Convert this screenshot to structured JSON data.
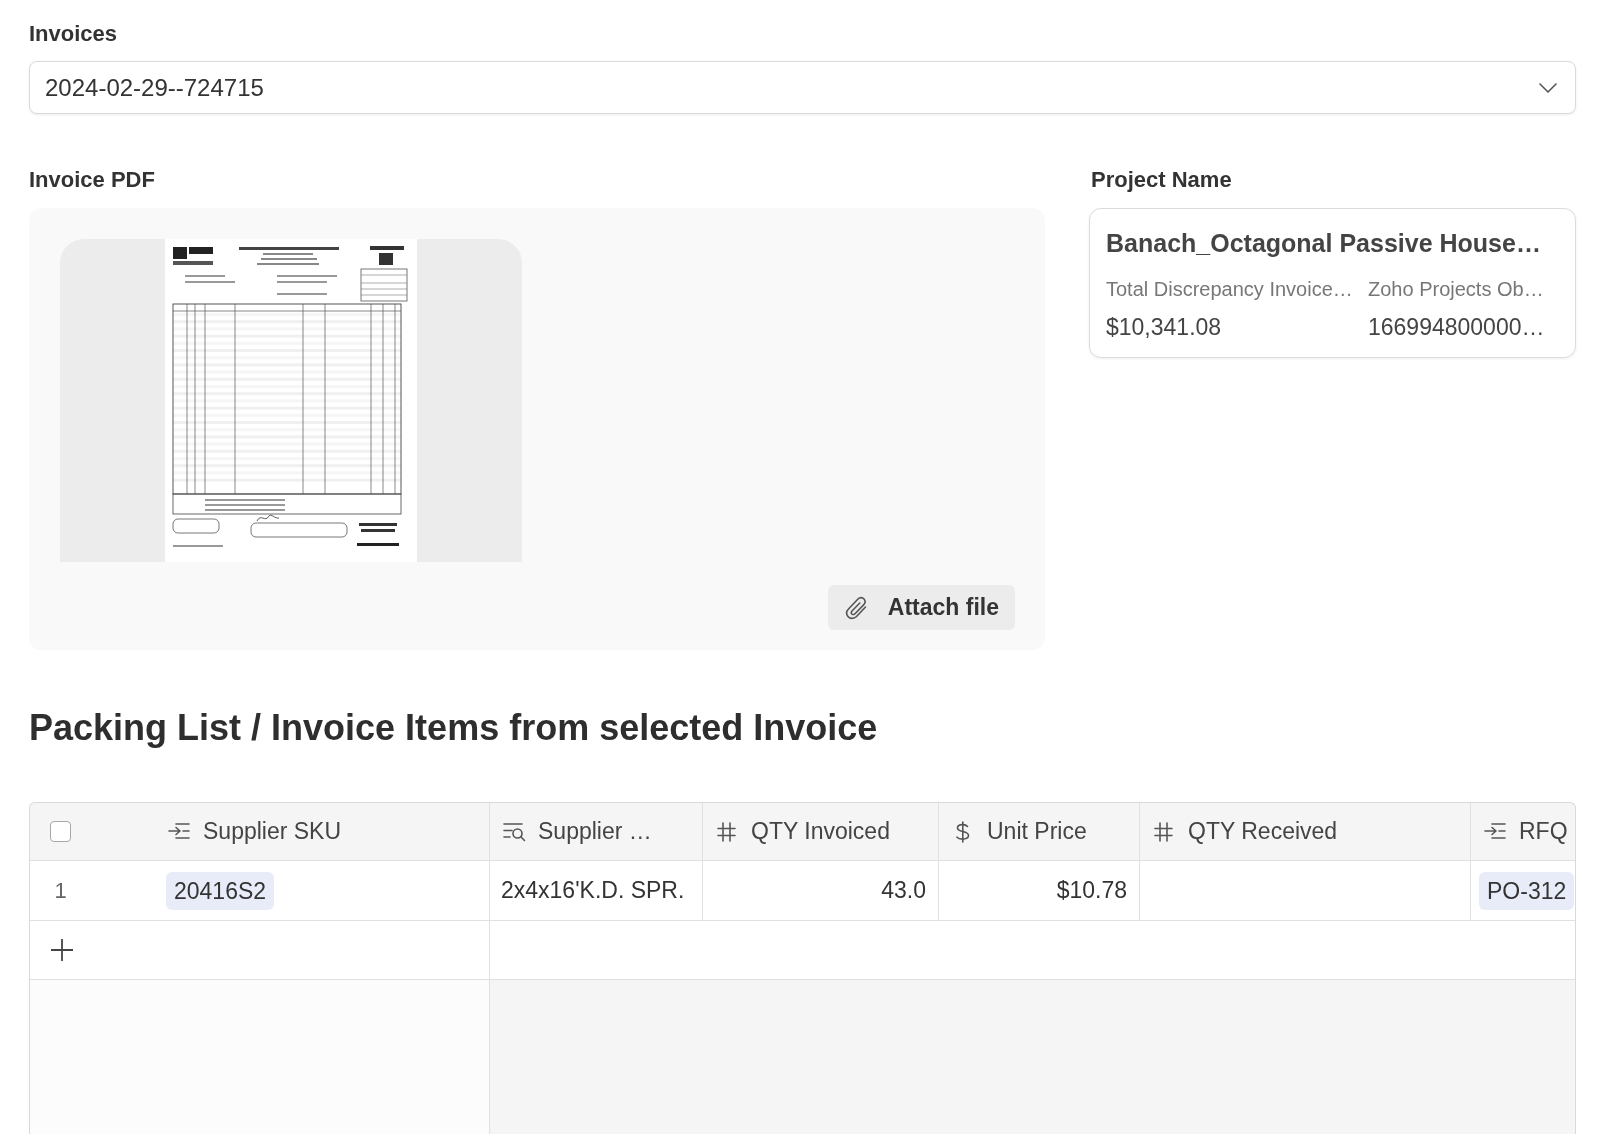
{
  "invoices": {
    "label": "Invoices",
    "value": "2024-02-29--724715"
  },
  "invoice_pdf": {
    "label": "Invoice PDF",
    "attach_button": "Attach file"
  },
  "project": {
    "label": "Project Name",
    "title": "Banach_Octagonal Passive House…",
    "fields": [
      {
        "label": "Total Discrepancy Invoice…",
        "value": "$10,341.08"
      },
      {
        "label": "Zoho Projects Ob…",
        "value": "166994800000…"
      }
    ]
  },
  "packing_list": {
    "title": "Packing List / Invoice Items from selected Invoice",
    "select_all_checked": false,
    "columns": [
      {
        "label": "Supplier SKU",
        "kind": "link"
      },
      {
        "label": "Supplier …",
        "kind": "lookup"
      },
      {
        "label": "QTY Invoiced",
        "kind": "number"
      },
      {
        "label": "Unit Price",
        "kind": "currency"
      },
      {
        "label": "QTY Received",
        "kind": "number"
      },
      {
        "label": "RFQ",
        "kind": "link"
      }
    ],
    "rows": [
      {
        "number": "1",
        "cells": [
          "20416S2",
          "2x4x16'K.D. SPR.",
          "43.0",
          "$10.78",
          null,
          "PO-312"
        ]
      }
    ]
  }
}
